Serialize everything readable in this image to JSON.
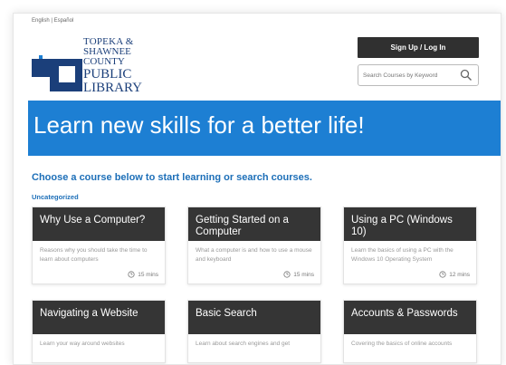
{
  "header": {
    "language_links": "English | Español",
    "logo": {
      "line1": "TOPEKA &",
      "line2": "SHAWNEE",
      "line3": "COUNTY",
      "line4": "PUBLIC",
      "line5": "LIBRARY"
    },
    "signup_label": "Sign Up / Log In",
    "search_placeholder": "Search Courses by Keyword"
  },
  "hero": {
    "title": "Learn new skills for a better life!"
  },
  "intro": "Choose a course below to start learning or search courses.",
  "category": "Uncategorized",
  "courses": [
    {
      "title": "Why Use a Computer?",
      "description": "Reasons why you should take the time to learn about computers",
      "duration": "15 mins"
    },
    {
      "title": "Getting Started on a Computer",
      "description": "What a computer is and how to use a mouse and keyboard",
      "duration": "15 mins"
    },
    {
      "title": "Using a PC (Windows 10)",
      "description": "Learn the basics of using a PC with the Windows 10 Operating System",
      "duration": "12 mins"
    },
    {
      "title": "Navigating a Website",
      "description": "Learn your way around websites",
      "duration": ""
    },
    {
      "title": "Basic Search",
      "description": "Learn about search engines and get",
      "duration": ""
    },
    {
      "title": "Accounts & Passwords",
      "description": "Covering the basics of online accounts",
      "duration": ""
    }
  ],
  "colors": {
    "brand_blue": "#1d7fd3",
    "logo_navy": "#1b3f7a",
    "dark": "#353535",
    "link_blue": "#1d6fb8"
  },
  "icons": {
    "search": "magnifier-icon",
    "duration": "clock-icon"
  }
}
